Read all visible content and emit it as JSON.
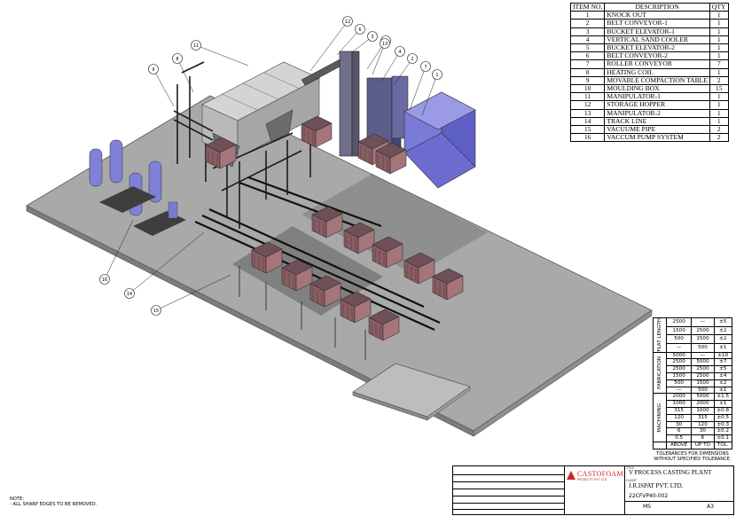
{
  "bom": {
    "headers": [
      "ITEM NO.",
      "DESCRIPTION",
      "QTY"
    ],
    "rows": [
      [
        "1",
        "KNOCK OUT",
        "1"
      ],
      [
        "2",
        "BELT CONVEYOR-1",
        "1"
      ],
      [
        "3",
        "BUCKET ELEVATOR-1",
        "1"
      ],
      [
        "4",
        "VERTICAL SAND COOLER",
        "1"
      ],
      [
        "5",
        "BUCKET ELEVATOR-2",
        "1"
      ],
      [
        "6",
        "BELT CONVEYOR-2",
        "1"
      ],
      [
        "7",
        "ROLLER CONVEYOR",
        "7"
      ],
      [
        "8",
        "HEATING COIL",
        "1"
      ],
      [
        "9",
        "MOVABLE COMPACTION TABLE",
        "2"
      ],
      [
        "10",
        "MOULDING BOX",
        "15"
      ],
      [
        "11",
        "MANIPULATOR-1",
        "1"
      ],
      [
        "12",
        "STORAGE HOPPER",
        "1"
      ],
      [
        "13",
        "MANIPULATOR-2",
        "1"
      ],
      [
        "14",
        "TRACK LINE",
        "1"
      ],
      [
        "15",
        "VACUUME PIPE",
        "2"
      ],
      [
        "16",
        "VACCUM PUMP SYSTEM",
        "2"
      ]
    ]
  },
  "callouts": [
    "1",
    "2",
    "3",
    "4",
    "5",
    "6",
    "7",
    "8",
    "9",
    "10",
    "11",
    "12",
    "13",
    "14",
    "15",
    "16"
  ],
  "tolerance": {
    "groups": [
      {
        "name": "FLAT LENGTH",
        "rows": [
          [
            "2500",
            "—",
            "±5"
          ],
          [
            "1500",
            "2500",
            "±2"
          ],
          [
            "500",
            "1500",
            "±2"
          ],
          [
            "—",
            "500",
            "±1"
          ]
        ]
      },
      {
        "name": "FABRICATION",
        "rows": [
          [
            "5000",
            "—",
            "±10"
          ],
          [
            "2500",
            "5000",
            "±7"
          ],
          [
            "2500",
            "2500",
            "±5"
          ],
          [
            "1500",
            "2500",
            "±4"
          ],
          [
            "500",
            "1500",
            "±2"
          ],
          [
            "—",
            "500",
            "±1"
          ]
        ]
      },
      {
        "name": "MACHINING",
        "rows": [
          [
            "2000",
            "5000",
            "±1.5"
          ],
          [
            "1000",
            "2000",
            "±1"
          ],
          [
            "315",
            "1000",
            "±0.8"
          ],
          [
            "120",
            "315",
            "±0.5"
          ],
          [
            "30",
            "120",
            "±0.3"
          ],
          [
            "6",
            "30",
            "±0.2"
          ],
          [
            "0.5",
            "6",
            "±0.1"
          ]
        ]
      }
    ],
    "header": [
      "ABOVE",
      "UP TO",
      "TOL."
    ],
    "note": "TOLERANCES FOR DIMENSIONS WITHOUT SPECIFIED TOLERANCE."
  },
  "title_block": {
    "company": "CASTOFOAM",
    "company_sub": "PROJECTS PVT LTD",
    "title_label": "TITLE",
    "title": "V PROCESS CASTING PLANT",
    "client_label": "CLIENT",
    "client": "J.R.ISPAT PVT. LTD.",
    "dwg_no": "22CFVP40-002",
    "material": "MS",
    "size": "A3"
  },
  "note": {
    "heading": "NOTE:",
    "text": "- ALL SHARP EDGES TO BE REMOVED."
  }
}
